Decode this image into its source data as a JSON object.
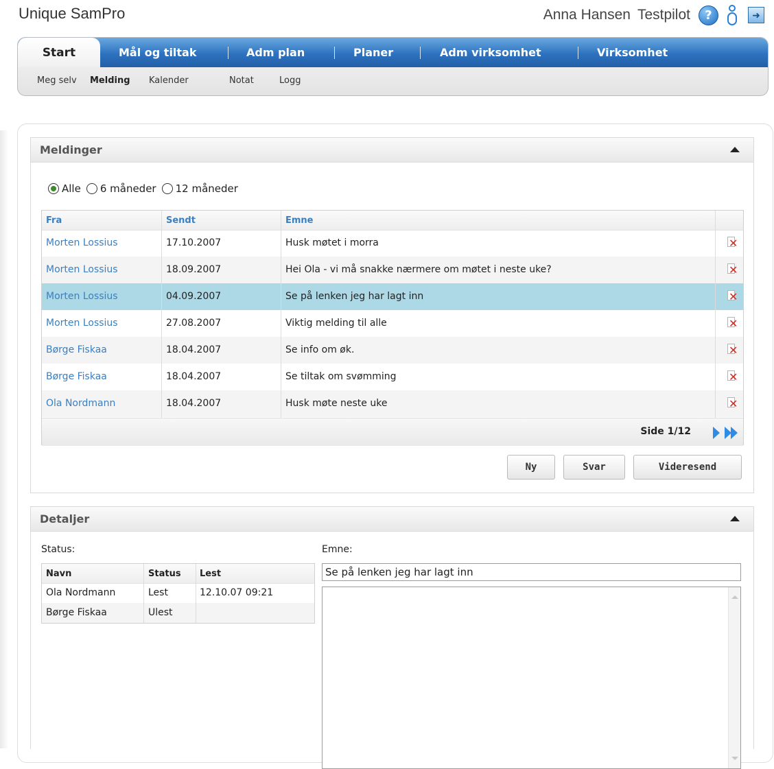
{
  "app": {
    "title": "Unique SamPro"
  },
  "user": {
    "name": "Anna Hansen",
    "role": "Testpilot"
  },
  "header_icons": [
    "help-icon",
    "user-icon",
    "exit-icon"
  ],
  "nav": {
    "tabs": [
      {
        "label": "Start",
        "active": true
      },
      {
        "label": "Mål og tiltak"
      },
      {
        "label": "Adm plan"
      },
      {
        "label": "Planer"
      },
      {
        "label": "Adm virksomhet"
      },
      {
        "label": "Virksomhet"
      }
    ],
    "subtabs": [
      {
        "label": "Meg selv"
      },
      {
        "label": "Melding",
        "active": true
      },
      {
        "label": "Kalender"
      },
      {
        "label": "Notat"
      },
      {
        "label": "Logg"
      }
    ]
  },
  "messages_panel": {
    "title": "Meldinger",
    "filters": [
      {
        "label": "Alle",
        "selected": true
      },
      {
        "label": "6 måneder"
      },
      {
        "label": "12 måneder"
      }
    ],
    "columns": [
      "Fra",
      "Sendt",
      "Emne"
    ],
    "rows": [
      {
        "from": "Morten Lossius",
        "sent": "17.10.2007",
        "subject": "Husk møtet i morra"
      },
      {
        "from": "Morten Lossius",
        "sent": "18.09.2007",
        "subject": "Hei Ola - vi må snakke nærmere om møtet i neste uke?"
      },
      {
        "from": "Morten Lossius",
        "sent": "04.09.2007",
        "subject": "Se på lenken jeg har lagt inn",
        "selected": true
      },
      {
        "from": "Morten Lossius",
        "sent": "27.08.2007",
        "subject": "Viktig melding til alle"
      },
      {
        "from": "Børge Fiskaa",
        "sent": "18.04.2007",
        "subject": "Se info om øk."
      },
      {
        "from": "Børge Fiskaa",
        "sent": "18.04.2007",
        "subject": "Se tiltak om svømming"
      },
      {
        "from": "Ola Nordmann",
        "sent": "18.04.2007",
        "subject": "Husk møte neste uke"
      }
    ],
    "pager": {
      "text": "Side 1/12"
    },
    "buttons": {
      "new": "Ny",
      "reply": "Svar",
      "forward": "Videresend"
    }
  },
  "details_panel": {
    "title": "Detaljer",
    "status_label": "Status:",
    "subject_label": "Emne:",
    "status_columns": [
      "Navn",
      "Status",
      "Lest"
    ],
    "status_rows": [
      {
        "name": "Ola Nordmann",
        "status": "Lest",
        "read": "12.10.07 09:21"
      },
      {
        "name": "Børge Fiskaa",
        "status": "Ulest",
        "read": ""
      }
    ],
    "subject_value": "Se på lenken jeg har lagt inn",
    "body_value": ""
  },
  "colors": {
    "nav_blue": "#2d72bf",
    "link_blue": "#3a7fc1",
    "selected_row": "#add8e6",
    "delete_red": "#d9281f"
  }
}
